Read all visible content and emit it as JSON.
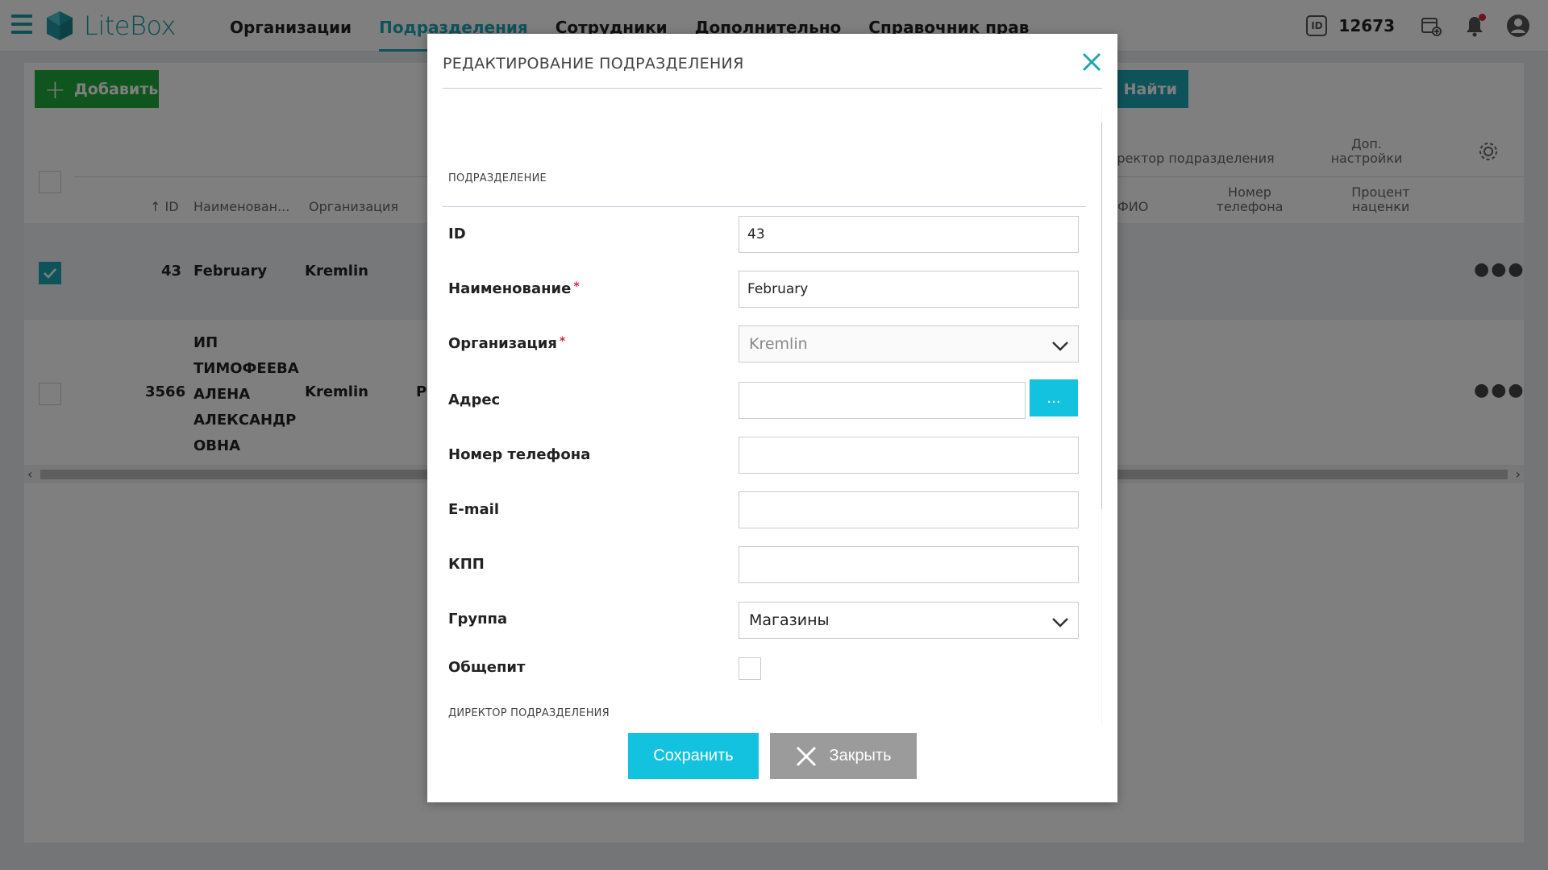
{
  "app": {
    "name": "LiteBox",
    "account_id": "12673",
    "id_badge": "ID"
  },
  "nav": [
    {
      "label": "Организации"
    },
    {
      "label": "Подразделения",
      "active": true
    },
    {
      "label": "Сотрудники"
    },
    {
      "label": "Дополнительно"
    },
    {
      "label": "Справочник прав"
    }
  ],
  "toolbar": {
    "add_label": "Добавить",
    "search_label": "Найти"
  },
  "table": {
    "headers": {
      "id": "ID",
      "name": "Наименован...",
      "org": "Организация",
      "director_group": "иректор подразделения",
      "fio": "ФИО",
      "phone": "Номер телефона",
      "extra": "Доп. настройки",
      "markup": "Процент наценки"
    },
    "rows": [
      {
        "id": "43",
        "name": "February",
        "org": "Kremlin",
        "selected": true
      },
      {
        "id": "3566",
        "name": "ИП ТИМОФЕЕВА АЛЕНА АЛЕКСАНДР ОВНА",
        "org": "Kremlin",
        "extra": "Р",
        "selected": false
      }
    ]
  },
  "modal": {
    "title": "РЕДАКТИРОВАНИЕ ПОДРАЗДЕЛЕНИЯ",
    "section_main": "ПОДРАЗДЕЛЕНИЕ",
    "section_director": "ДИРЕКТОР ПОДРАЗДЕЛЕНИЯ",
    "fields": {
      "id": {
        "label": "ID",
        "value": "43"
      },
      "name": {
        "label": "Наименование",
        "value": "February",
        "required": "*"
      },
      "org": {
        "label": "Организация",
        "value": "Kremlin",
        "required": "*"
      },
      "address": {
        "label": "Адрес",
        "value": "",
        "button": "..."
      },
      "phone": {
        "label": "Номер телефона",
        "value": ""
      },
      "email": {
        "label": "E-mail",
        "value": ""
      },
      "kpp": {
        "label": "КПП",
        "value": ""
      },
      "group": {
        "label": "Группа",
        "value": "Магазины"
      },
      "catering": {
        "label": "Общепит",
        "checked": false
      }
    },
    "save_label": "Сохранить",
    "close_label": "Закрыть"
  },
  "colors": {
    "accent": "#1fa6b4",
    "add_green": "#1faa3a",
    "save_cyan": "#13c2df",
    "close_gray": "#9b9b9b"
  }
}
